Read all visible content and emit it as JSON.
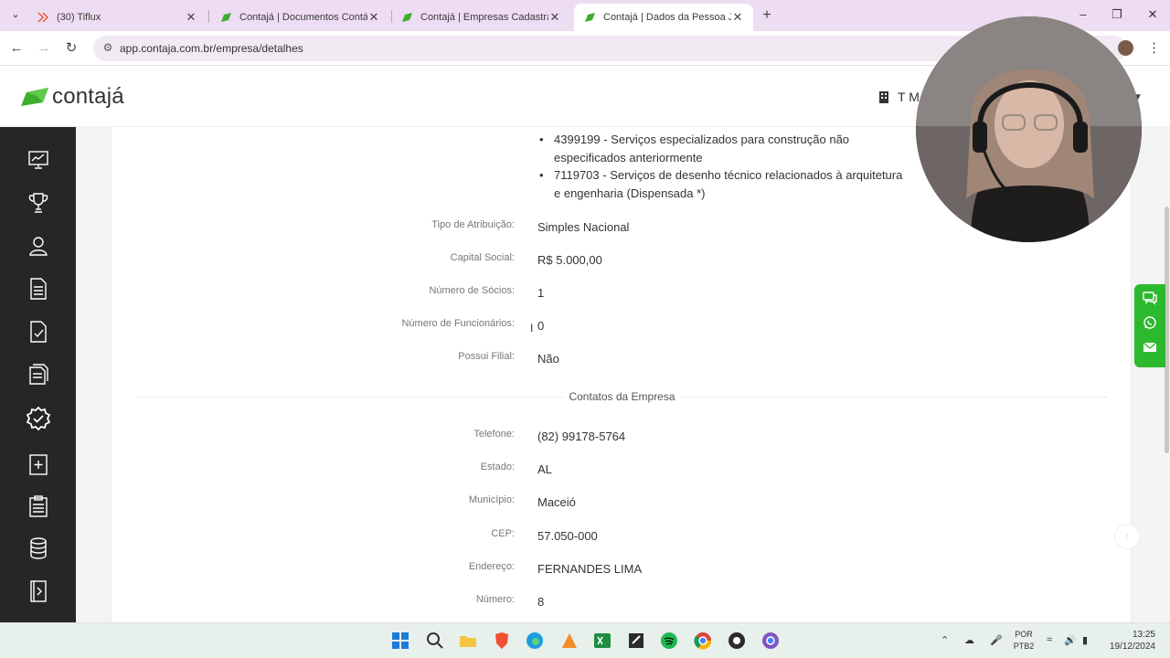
{
  "browser": {
    "tabs": [
      {
        "title": "(30) Tiflux",
        "active": false
      },
      {
        "title": "Contajá | Documentos Contábe",
        "active": false
      },
      {
        "title": "Contajá | Empresas Cadastradas",
        "active": false
      },
      {
        "title": "Contajá | Dados da Pessoa Juríd",
        "active": true
      }
    ],
    "url": "app.contaja.com.br/empresa/detalhes"
  },
  "header": {
    "logo_text": "contajá",
    "company_label": "T M"
  },
  "cnae": {
    "items": [
      "4399199 - Serviços especializados para construção não especificados anteriormente",
      "7119703 - Serviços de desenho técnico relacionados à arquitetura e engenharia (Dispensada *)"
    ]
  },
  "company_details": [
    {
      "label": "Tipo de Atribuição:",
      "value": "Simples Nacional"
    },
    {
      "label": "Capital Social:",
      "value": "R$ 5.000,00"
    },
    {
      "label": "Número de Sócios:",
      "value": "1"
    },
    {
      "label": "Número de Funcionários:",
      "value": "0"
    },
    {
      "label": "Possui Filial:",
      "value": "Não"
    }
  ],
  "contacts_section_title": "Contatos da Empresa",
  "contacts": [
    {
      "label": "Telefone:",
      "value": "(82) 99178-5764"
    },
    {
      "label": "Estado:",
      "value": "AL"
    },
    {
      "label": "Município:",
      "value": "Maceió"
    },
    {
      "label": "CEP:",
      "value": "57.050-000"
    },
    {
      "label": "Endereço:",
      "value": "FERNANDES LIMA"
    },
    {
      "label": "Número:",
      "value": "8"
    }
  ],
  "taskbar": {
    "lang_top": "POR",
    "lang_bottom": "PTB2",
    "time": "13:25",
    "date": "19/12/2024"
  },
  "colors": {
    "brand_green": "#2db92d",
    "sidebar": "#262626",
    "tabstrip": "#eedcf2"
  }
}
